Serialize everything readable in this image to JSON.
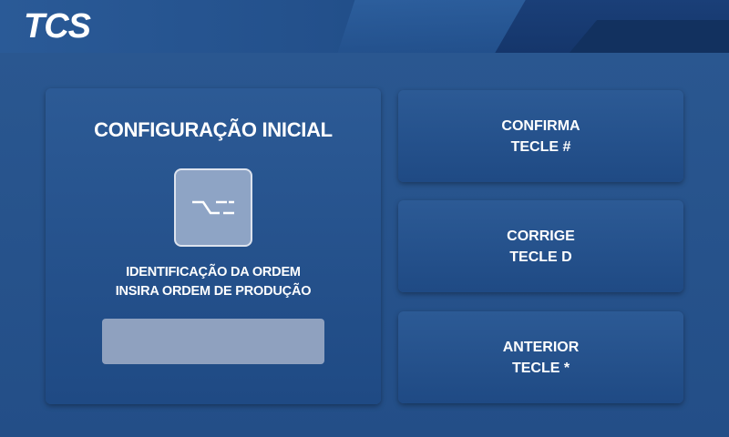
{
  "header": {
    "logo": "TCS"
  },
  "panel": {
    "title": "CONFIGURAÇÃO INICIAL",
    "icon": "order-icon",
    "line1": "IDENTIFICAÇÃO DA ORDEM",
    "line2": "INSIRA ORDEM DE PRODUÇÃO",
    "input_value": ""
  },
  "buttons": [
    {
      "line1": "CONFIRMA",
      "line2": "TECLE #"
    },
    {
      "line1": "CORRIGE",
      "line2": "TECLE D"
    },
    {
      "line1": "ANTERIOR",
      "line2": "TECLE *"
    }
  ],
  "colors": {
    "background": "#234d86",
    "panel": "#2a5790",
    "input": "#8fa1bf",
    "text": "#ffffff"
  }
}
